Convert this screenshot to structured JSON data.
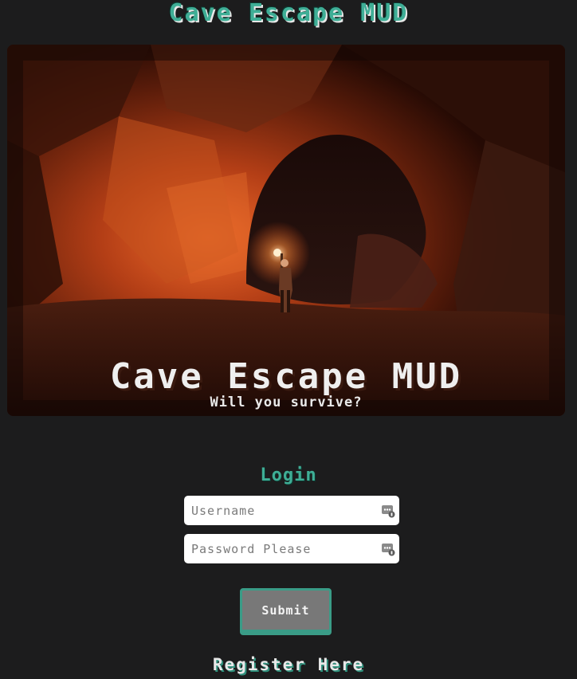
{
  "site": {
    "title": "Cave Escape MUD"
  },
  "hero": {
    "title": "Cave Escape MUD",
    "subtitle": "Will you survive?",
    "image": "cave-with-torch-bearer"
  },
  "login": {
    "heading": "Login",
    "username_placeholder": "Username",
    "password_placeholder": "Password Please",
    "field_icon": "password-manager-icon",
    "submit_label": "Submit"
  },
  "register": {
    "label": "Register Here"
  },
  "colors": {
    "background": "#1c1c1d",
    "accent": "#3fae96",
    "button": "#787878"
  }
}
